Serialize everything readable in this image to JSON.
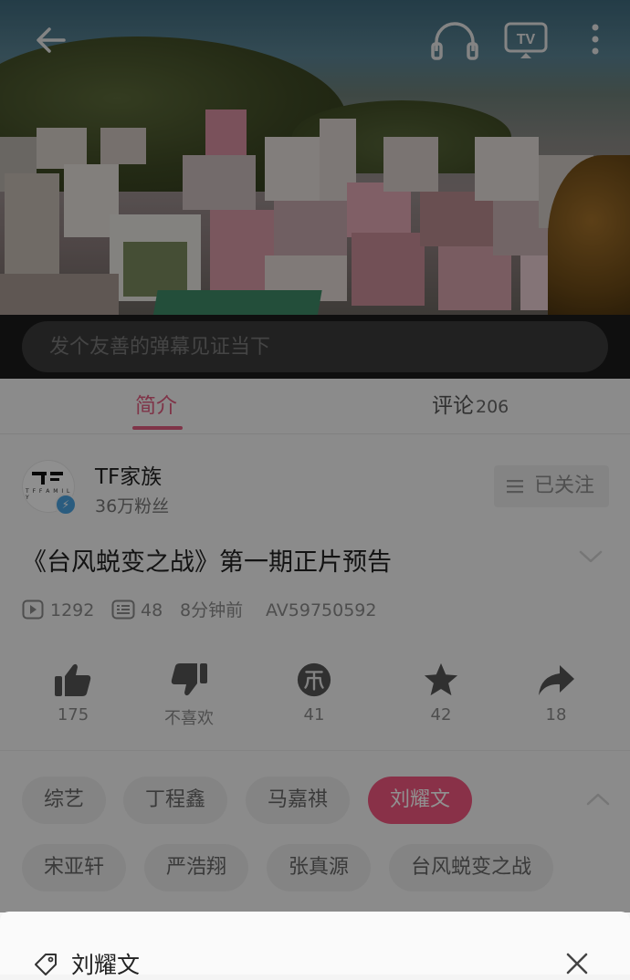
{
  "player": {
    "danmaku_placeholder": "发个友善的弹幕见证当下"
  },
  "tabs": [
    {
      "label": "简介",
      "active": true
    },
    {
      "label": "评论",
      "count": "206",
      "active": false
    }
  ],
  "uploader": {
    "name": "TF家族",
    "fans": "36万粉丝",
    "avatar_text": "T F F A M I L Y",
    "follow_label": "已关注"
  },
  "video": {
    "title": "《台风蜕变之战》第一期正片预告",
    "plays": "1292",
    "danmaku_count": "48",
    "time_ago": "8分钟前",
    "av_id": "AV59750592"
  },
  "actions": {
    "like": "175",
    "dislike": "不喜欢",
    "coin": "41",
    "favorite": "42",
    "share": "18"
  },
  "tags": [
    "综艺",
    "丁程鑫",
    "马嘉祺",
    "刘耀文",
    "宋亚轩",
    "严浩翔",
    "张真源",
    "台风蜕变之战"
  ],
  "active_tag": "刘耀文",
  "sheet": {
    "title": "刘耀文"
  },
  "colors": {
    "accent": "#e05c7f",
    "tag_active": "#f1567f"
  }
}
